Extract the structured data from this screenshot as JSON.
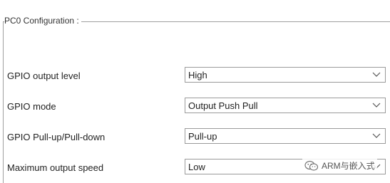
{
  "group": {
    "title": "PC0 Configuration :"
  },
  "rows": [
    {
      "label": "GPIO output level",
      "value": "High"
    },
    {
      "label": "GPIO mode",
      "value": "Output Push Pull"
    },
    {
      "label": "GPIO Pull-up/Pull-down",
      "value": "Pull-up"
    },
    {
      "label": "Maximum output speed",
      "value": "Low"
    }
  ],
  "watermark": {
    "text": "ARM与嵌入式",
    "icon": "wechat-logo-icon"
  },
  "icons": {
    "dropdown": "chevron-down-icon"
  },
  "colors": {
    "border": "#9a9a9a",
    "text": "#222222",
    "background": "#ffffff"
  }
}
